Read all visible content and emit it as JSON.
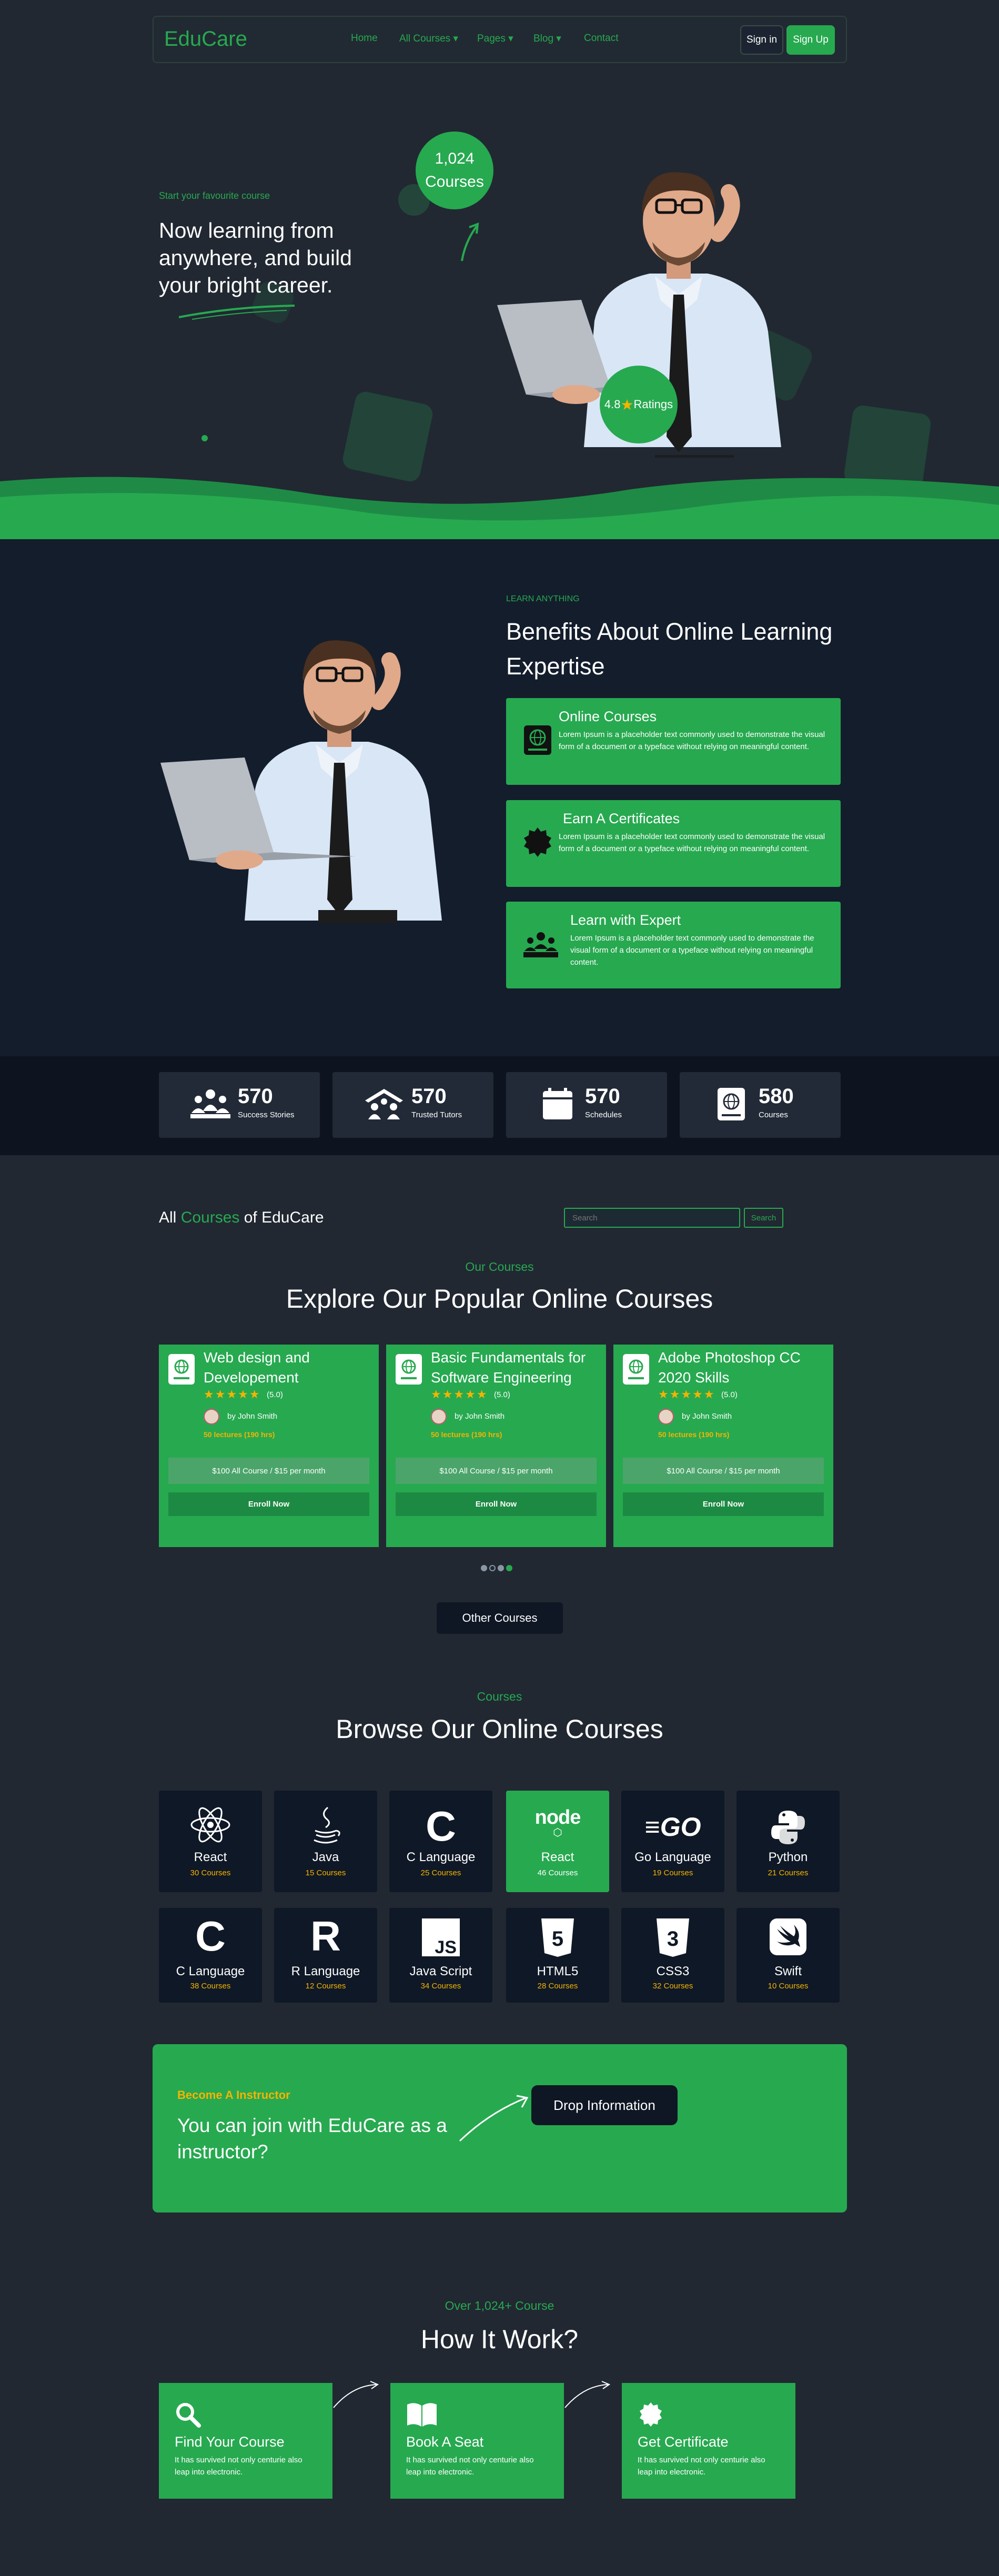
{
  "nav": {
    "logo": "EduCare",
    "links": [
      "Home",
      "All Courses ▾",
      "Pages ▾",
      "Blog ▾",
      "Contact"
    ],
    "signin": "Sign in",
    "signup": "Sign Up"
  },
  "hero": {
    "tag": "Start your favourite course",
    "title": "Now learning from anywhere, and build your bright career.",
    "courses_count": "1,024",
    "courses_label": "Courses",
    "rating_value": "4.8",
    "rating_label": "Ratings"
  },
  "benefits": {
    "tag": "LEARN ANYTHING",
    "title": "Benefits About Online Learning Expertise",
    "items": [
      {
        "title": "Online Courses",
        "desc": "Lorem Ipsum is a placeholder text commonly used to demonstrate the visual form of a document or a typeface without relying on meaningful content.",
        "icon": "course-book-icon"
      },
      {
        "title": "Earn A Certificates",
        "desc": "Lorem Ipsum is a placeholder text commonly used to demonstrate the visual form of a document or a typeface without relying on meaningful content.",
        "icon": "certificate-seal-icon"
      },
      {
        "title": "Learn with Expert",
        "desc": "Lorem Ipsum is a placeholder text commonly used to demonstrate the visual form of a document or a typeface without relying on meaningful content.",
        "icon": "expert-team-icon"
      }
    ]
  },
  "stats": [
    {
      "number": "570",
      "label": "Success Stories",
      "icon": "people-group-icon"
    },
    {
      "number": "570",
      "label": "Trusted Tutors",
      "icon": "school-icon"
    },
    {
      "number": "570",
      "label": "Schedules",
      "icon": "calendar-icon"
    },
    {
      "number": "580",
      "label": "Courses",
      "icon": "course-book-icon"
    }
  ],
  "all_courses": {
    "title_pre": "All ",
    "title_accent": "Courses",
    "title_post": " of EduCare",
    "search_placeholder": "Search",
    "search_button": "Search"
  },
  "popular": {
    "tag": "Our Courses",
    "title": "Explore Our Popular Online Courses",
    "courses": [
      {
        "title": "Web design and Developement",
        "stars": "★★★★★",
        "rating": "(5.0)",
        "author": "by John Smith",
        "lectures": "50 lectures (190 hrs)",
        "price": "$100 All Course / $15 per month",
        "enroll": "Enroll Now"
      },
      {
        "title": "Basic Fundamentals for Software Engineering",
        "stars": "★★★★★",
        "rating": "(5.0)",
        "author": "by John Smith",
        "lectures": "50 lectures (190 hrs)",
        "price": "$100 All Course / $15 per month",
        "enroll": "Enroll Now"
      },
      {
        "title": "Adobe Photoshop CC 2020 Skills",
        "stars": "★★★★★",
        "rating": "(5.0)",
        "author": "by John Smith",
        "lectures": "50 lectures (190 hrs)",
        "price": "$100 All Course / $15 per month",
        "enroll": "Enroll Now"
      }
    ],
    "other_button": "Other Courses"
  },
  "browse": {
    "tag": "Courses",
    "title": "Browse Our Online Courses",
    "tiles": [
      {
        "name": "React",
        "count": "30 Courses",
        "icon": "react-icon"
      },
      {
        "name": "Java",
        "count": "15 Courses",
        "icon": "java-icon"
      },
      {
        "name": "C Language",
        "count": "25 Courses",
        "icon": "c-language-icon"
      },
      {
        "name": "React",
        "count": "46 Courses",
        "icon": "node-icon"
      },
      {
        "name": "Go Language",
        "count": "19 Courses",
        "icon": "go-icon"
      },
      {
        "name": "Python",
        "count": "21 Courses",
        "icon": "python-icon"
      },
      {
        "name": "C Language",
        "count": "38 Courses",
        "icon": "c-language-icon"
      },
      {
        "name": "R Language",
        "count": "12 Courses",
        "icon": "r-language-icon"
      },
      {
        "name": "Java Script",
        "count": "34 Courses",
        "icon": "javascript-icon"
      },
      {
        "name": "HTML5",
        "count": "28 Courses",
        "icon": "html5-icon"
      },
      {
        "name": "CSS3",
        "count": "32 Courses",
        "icon": "css3-icon"
      },
      {
        "name": "Swift",
        "count": "10 Courses",
        "icon": "swift-icon"
      }
    ]
  },
  "instructor": {
    "tag": "Become A Instructor",
    "title": "You can join with EduCare as a instructor?",
    "button": "Drop Information"
  },
  "how": {
    "tag": "Over 1,024+ Course",
    "title": "How It Work?",
    "steps": [
      {
        "title": "Find Your Course",
        "desc": "It has survived not only centurie also leap into electronic.",
        "icon": "search-icon"
      },
      {
        "title": "Book A Seat",
        "desc": "It has survived not only centurie also leap into electronic.",
        "icon": "open-book-icon"
      },
      {
        "title": "Get Certificate",
        "desc": "It has survived not only centurie also leap into electronic.",
        "icon": "certificate-seal-icon"
      }
    ]
  },
  "colors": {
    "accent": "#27a950",
    "background": "#212832",
    "dark": "#141d2c",
    "star": "#f5b400"
  }
}
